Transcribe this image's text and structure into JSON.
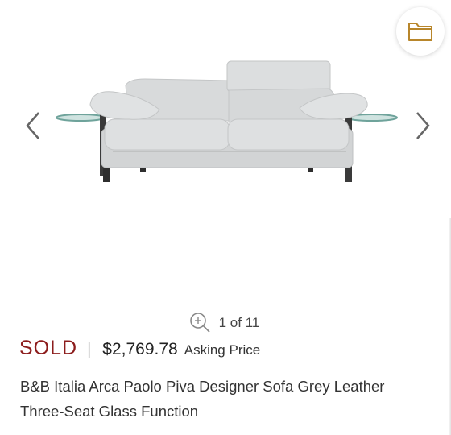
{
  "gallery": {
    "counter_text": "1 of 11",
    "icons": {
      "prev": "chevron-left-icon",
      "next": "chevron-right-icon",
      "save": "folder-icon",
      "zoom": "zoom-in-icon"
    },
    "colors": {
      "folder_accent": "#b8862b",
      "chevron": "#666666"
    }
  },
  "listing": {
    "status": "SOLD",
    "status_color": "#8c1c1c",
    "separator": "|",
    "original_price": "$2,769.78",
    "price_label": "Asking Price",
    "title": "B&B Italia Arca Paolo Piva Designer Sofa Grey Leather Three-Seat Glass Function"
  }
}
